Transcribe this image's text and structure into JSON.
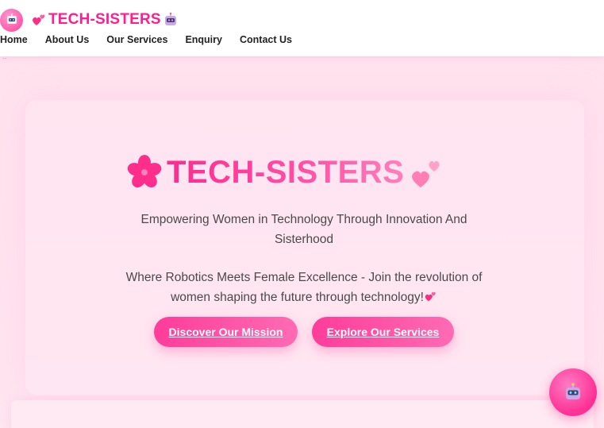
{
  "header": {
    "brand_text": "TECH-SISTERS",
    "nav": [
      {
        "label": "Home"
      },
      {
        "label": "About Us"
      },
      {
        "label": "Our Services"
      },
      {
        "label": "Enquiry"
      },
      {
        "label": "Contact Us"
      }
    ]
  },
  "hero": {
    "title": "TECH-SISTERS",
    "tagline": "Empowering Women in Technology Through Innovation And Sisterhood",
    "subtext": "Where Robotics Meets Female Excellence - Join the revolution of women shaping the future through technology!",
    "primary_button": "Discover Our Mission",
    "secondary_button": "Explore Our Services"
  },
  "icons": {
    "brand_avatar": "robot-icon",
    "brand_heart": "two-hearts-icon",
    "brand_robot": "robot-icon",
    "title_flower": "cherry-blossom-icon",
    "title_hearts": "two-hearts-icon",
    "subtext_heart": "two-hearts-icon",
    "chat_fab": "robot-icon"
  },
  "colors": {
    "brand_pink": "#ff1e8e",
    "button_gradient_start": "#ff3c9a",
    "button_gradient_end": "#ff6bb4",
    "page_background": "#ffe4ef"
  }
}
